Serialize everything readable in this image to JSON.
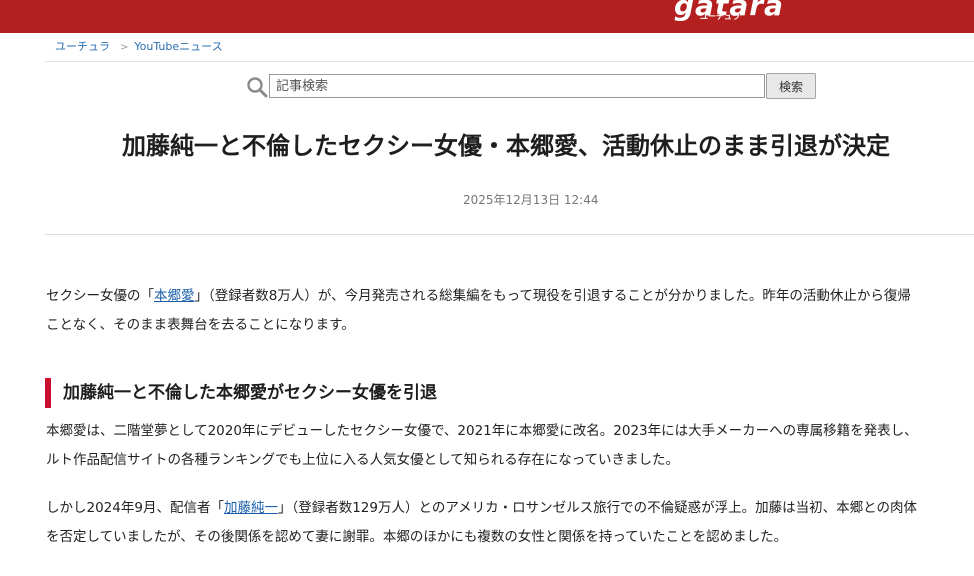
{
  "header": {
    "logo_main": "gatara",
    "logo_sub": "ユーチュラ"
  },
  "breadcrumb": {
    "home": "ユーチュラ",
    "separator": ">",
    "category": "YouTubeニュース"
  },
  "search": {
    "placeholder": "記事検索",
    "button_label": "検索"
  },
  "article": {
    "title": "加藤純一と不倫したセクシー女優・本郷愛、活動休止のまま引退が決定",
    "date": "2025年12月13日 12:44",
    "intro": {
      "pre_link": "セクシー女優の「",
      "link_text": "本郷愛",
      "post_link": "」（登録者数8万人）が、今月発売される総集編をもって現役を引退することが分かりました。昨年の活動休止から復帰",
      "line2": "ことなく、そのまま表舞台を去ることになります。"
    },
    "section_heading": "加藤純一と不倫した本郷愛がセクシー女優を引退",
    "para1": {
      "line1": "本郷愛は、二階堂夢として2020年にデビューしたセクシー女優で、2021年に本郷愛に改名。2023年には大手メーカーへの専属移籍を発表し、",
      "line2": "ルト作品配信サイトの各種ランキングでも上位に入る人気女優として知られる存在になっていきました。"
    },
    "para2": {
      "pre_link": "しかし2024年9月、配信者「",
      "link_text": "加藤純一",
      "post_link": "」（登録者数129万人）とのアメリカ・ロサンゼルス旅行での不倫疑惑が浮上。加藤は当初、本郷との肉体",
      "line2": "を否定していましたが、その後関係を認めて妻に謝罪。本郷のほかにも複数の女性と関係を持っていたことを認めました。"
    }
  },
  "colors": {
    "header_bg": "#b41f20",
    "link": "#1a5ea8",
    "heading_accent": "#c8102e"
  }
}
